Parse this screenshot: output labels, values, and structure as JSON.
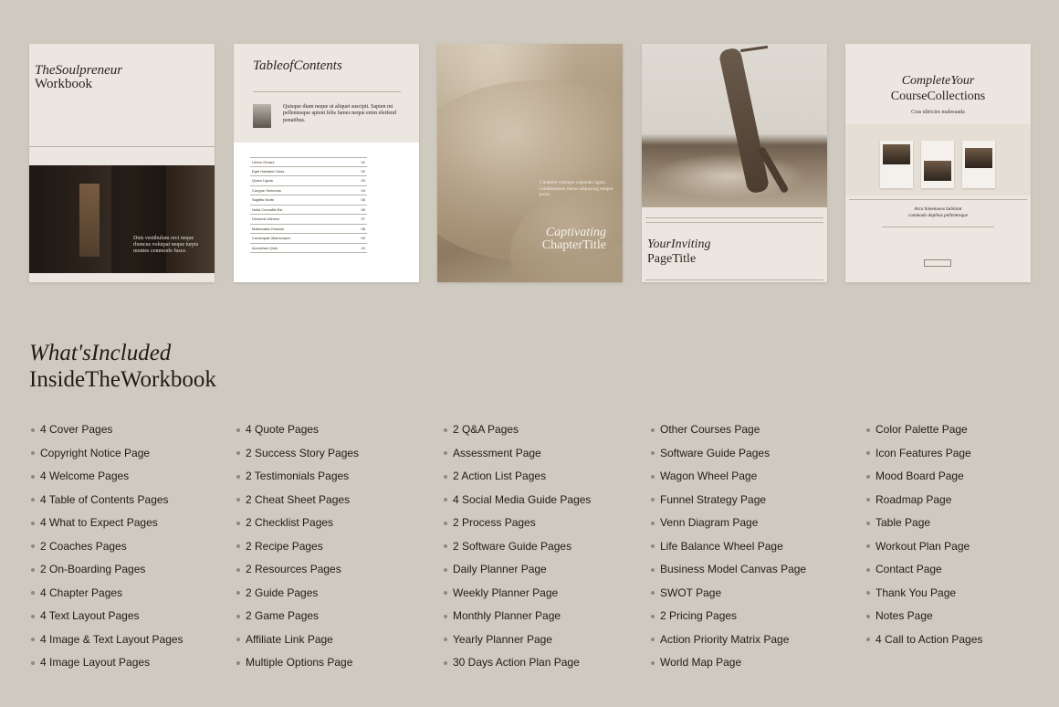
{
  "thumbs": {
    "t1": {
      "title_italic": "TheSoulpreneur",
      "title_plain": "Workbook",
      "quote": "Duis vestibulum orci neque rhoncus volutpat neque turpis montes commodo fusce."
    },
    "t2": {
      "title": "TableofContents",
      "intro": "Quisque diam neque ut aliquet suscipit. Sapien mi pellentesque aptent felis fames neque enim eleifend penatibus.",
      "toc_items": [
        {
          "label": "Libero Ornare",
          "page": "01"
        },
        {
          "label": "Eget Habitant Class",
          "page": "02"
        },
        {
          "label": "Quam Ligula",
          "page": "03"
        },
        {
          "label": "Congue Senectus",
          "page": "04"
        },
        {
          "label": "Sagittis Morbi",
          "page": "05"
        },
        {
          "label": "Nulla Convallis Est",
          "page": "06"
        },
        {
          "label": "Dictumst Ultrices",
          "page": "07"
        },
        {
          "label": "Malesuada Gravida",
          "page": "08"
        },
        {
          "label": "Consequat Ullamcorper",
          "page": "09"
        },
        {
          "label": "Accumsan Quis",
          "page": "10"
        }
      ]
    },
    "t3": {
      "body": "Curabitur tristique vulputate ligula condimentum metus adipiscing tempor proin.",
      "title_italic": "Captivating",
      "title_plain": "ChapterTitle"
    },
    "t4": {
      "title_italic": "YourInviting",
      "title_plain": "PageTitle"
    },
    "t5": {
      "title_italic": "CompleteYour",
      "title_plain": "CourseCollections",
      "subtitle": "Cras ultricies malesuada",
      "quote_line1": "Arcu himenaeos habitant",
      "quote_line2": "commodo dapibus pellentesque"
    }
  },
  "headline": {
    "line1": "What'sIncluded",
    "line2": "InsideTheWorkbook"
  },
  "columns": [
    [
      "4 Cover Pages",
      "Copyright Notice Page",
      "4 Welcome Pages",
      "4 Table of Contents Pages",
      "4 What to Expect Pages",
      "2 Coaches Pages",
      "2 On-Boarding Pages",
      "4 Chapter Pages",
      "4 Text Layout Pages",
      "4 Image & Text Layout Pages",
      "4 Image Layout Pages"
    ],
    [
      "4 Quote Pages",
      "2 Success Story Pages",
      "2 Testimonials Pages",
      "2 Cheat Sheet Pages",
      "2 Checklist Pages",
      "2 Recipe Pages",
      "2 Resources Pages",
      "2 Guide Pages",
      "2 Game Pages",
      "Affiliate Link Page",
      "Multiple Options Page"
    ],
    [
      "2 Q&A Pages",
      "Assessment Page",
      "2 Action List Pages",
      "4 Social Media Guide Pages",
      "2 Process Pages",
      "2 Software Guide Pages",
      "Daily Planner Page",
      "Weekly Planner Page",
      "Monthly Planner Page",
      "Yearly Planner Page",
      "30 Days Action Plan Page"
    ],
    [
      "Other Courses Page",
      "Software Guide Pages",
      "Wagon Wheel Page",
      "Funnel Strategy Page",
      "Venn Diagram Page",
      "Life Balance Wheel Page",
      "Business Model Canvas Page",
      "SWOT Page",
      "2 Pricing Pages",
      "Action Priority Matrix Page",
      "World Map Page"
    ],
    [
      "Color Palette Page",
      "Icon Features Page",
      "Mood Board Page",
      "Roadmap Page",
      "Table Page",
      "Workout Plan Page",
      "Contact Page",
      "Thank You Page",
      "Notes Page",
      "4 Call to Action Pages"
    ]
  ]
}
